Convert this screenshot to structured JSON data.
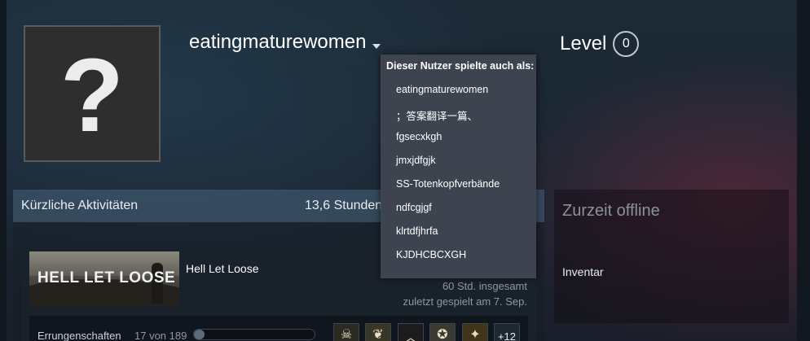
{
  "profile": {
    "avatar_glyph": "?",
    "username": "eatingmaturewomen",
    "level_label": "Level",
    "level_value": "0"
  },
  "alias_menu": {
    "title": "Dieser Nutzer spielte auch als:",
    "items": [
      "eatingmaturewomen",
      "；答案翻译一篇、",
      "fgsecxkgh",
      "jmxjdfgjk",
      "SS-Totenkopfverbände",
      "ndfcgjgf",
      "klrtdfjhrfa",
      "KJDHCBCXGH"
    ]
  },
  "activity": {
    "title": "Kürzliche Aktivitäten",
    "hours_summary": "13,6 Stunden",
    "game": {
      "name": "Hell Let Loose",
      "capsule_logo": "HELL LET LOOSE",
      "total_playtime": "60 Std. insgesamt",
      "last_played": "zuletzt gespielt am 7. Sep.",
      "achievements_label": "Errungenschaften",
      "achievements_count": "17 von 189",
      "achievements_progress": 0.09,
      "achievement_icons": [
        "skull-medal-icon",
        "wreath-badge-icon",
        "chevron-up-icon",
        "medal-icon",
        "gold-star-icon"
      ],
      "more_achievements": "+12"
    }
  },
  "status": {
    "text": "Zurzeit offline",
    "inventory_link": "Inventar"
  },
  "colors": {
    "background": "#1b2633",
    "dropdown": "#3d4450",
    "offline_text": "#8b929a"
  }
}
